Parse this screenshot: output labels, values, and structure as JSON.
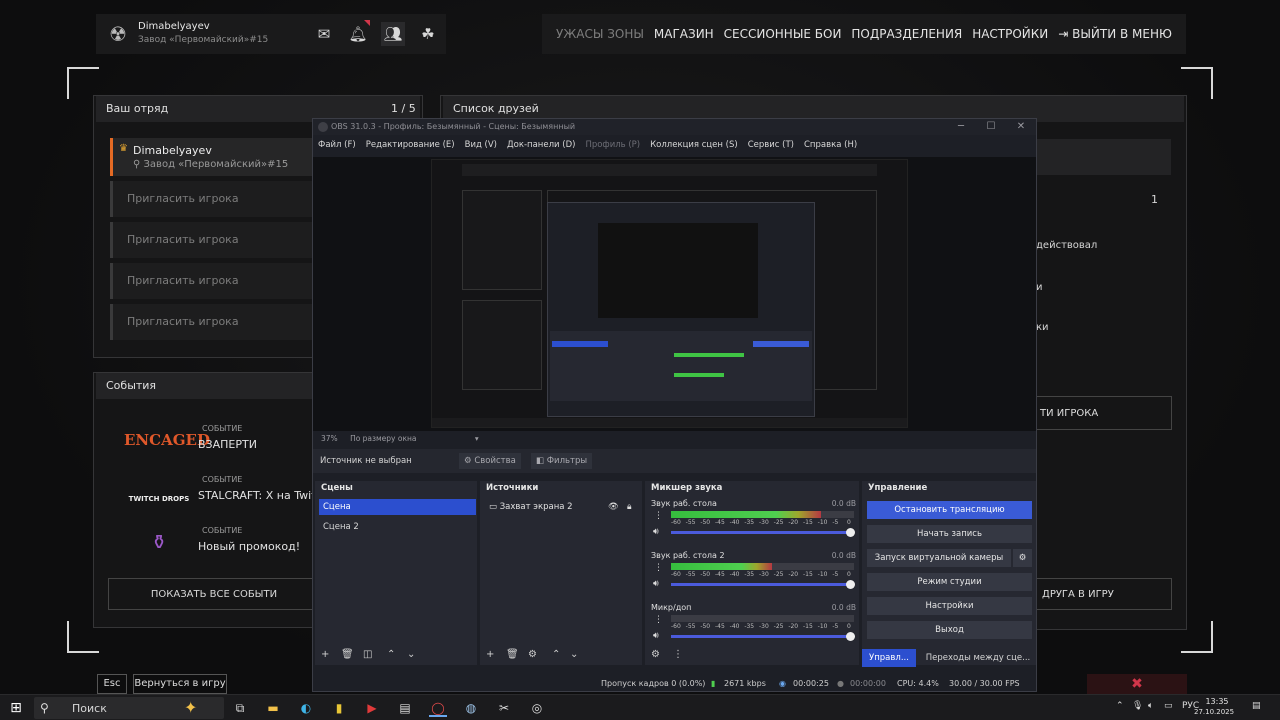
{
  "header": {
    "username": "Dimabelyayev",
    "location": "Завод «Первомайский»#15",
    "menu": [
      "УЖАСЫ ЗОНЫ",
      "МАГАЗИН",
      "СЕССИОННЫЕ БОИ",
      "ПОДРАЗДЕЛЕНИЯ",
      "НАСТРОЙКИ"
    ],
    "exit": "ВЫЙТИ В МЕНЮ"
  },
  "squad": {
    "title": "Ваш отряд",
    "count": "1 / 5",
    "member_name": "Dimabelyayev",
    "member_location": "Завод «Первомайский»#15",
    "invite": [
      "Пригласить игрока",
      "Пригласить игрока",
      "Пригласить игрока",
      "Пригласить игрока"
    ]
  },
  "friends": {
    "title": "Список друзей",
    "count": "1",
    "row_a": "действовал",
    "row_b": "и",
    "row_c": "ки",
    "invite_btn": "ТИ ИГРОКА",
    "invite_to_game": "ДРУГА В ИГРУ"
  },
  "events": {
    "title": "События",
    "items": [
      {
        "tag": "СОБЫТИЕ",
        "title": "ВЗАПЕРТИ",
        "logo": "ENCAGED"
      },
      {
        "tag": "СОБЫТИЕ",
        "title": "STALCRAFT: X на Twit",
        "logo": "TWITCH DROPS"
      },
      {
        "tag": "СОБЫТИЕ",
        "title": "Новый промокод!",
        "logo": ""
      }
    ],
    "show_all": "ПОКАЗАТЬ ВСЕ СОБЫТИ"
  },
  "bottom": {
    "esc": "Esc",
    "back": "Вернуться в игру"
  },
  "obs": {
    "title": "OBS 31.0.3 - Профиль: Безымянный - Сцены: Безымянный",
    "menu": [
      "Файл (F)",
      "Редактирование (E)",
      "Вид (V)",
      "Док-панели (D)",
      "Профиль (P)",
      "Коллекция сцен (S)",
      "Сервис (T)",
      "Справка (H)"
    ],
    "zoom": "37%",
    "zoom_mode": "По размеру окна",
    "no_source": "Источник не выбран",
    "properties": "Свойства",
    "filters": "Фильтры",
    "scenes_title": "Сцены",
    "scenes": [
      "Сцена",
      "Сцена 2"
    ],
    "sources_title": "Источники",
    "sources": [
      "Захват экрана 2"
    ],
    "mixer_title": "Микшер звука",
    "mixer": [
      {
        "name": "Звук раб. стола",
        "db": "0.0 dB",
        "level": 0.82
      },
      {
        "name": "Звук раб. стола 2",
        "db": "0.0 dB",
        "level": 0.55
      },
      {
        "name": "Микр/доп",
        "db": "0.0 dB",
        "level": 0.0
      }
    ],
    "scale": [
      "-60",
      "-55",
      "-50",
      "-45",
      "-40",
      "-35",
      "-30",
      "-25",
      "-20",
      "-15",
      "-10",
      "-5",
      "0"
    ],
    "controls_title": "Управление",
    "controls": [
      "Остановить трансляцию",
      "Начать запись",
      "Запуск виртуальной камеры",
      "Режим студии",
      "Настройки",
      "Выход"
    ],
    "tab_controls": "Управл...",
    "tab_transitions": "Переходы между сце...",
    "status": {
      "dropped": "Пропуск кадров 0 (0.0%)",
      "kbps": "2671 kbps",
      "live": "00:00:25",
      "rec": "00:00:00",
      "cpu": "CPU: 4.4%",
      "fps": "30.00 / 30.00 FPS"
    }
  },
  "taskbar": {
    "search": "Поиск",
    "lang": "РУС",
    "time": "13:35",
    "date": "27.10.2025"
  }
}
